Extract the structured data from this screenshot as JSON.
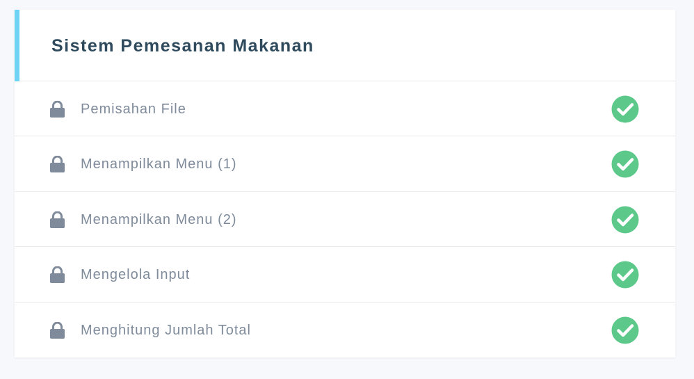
{
  "course": {
    "title": "Sistem Pemesanan Makanan"
  },
  "lessons": [
    {
      "label": "Pemisahan File",
      "status": "completed",
      "lock_icon": "lock-icon",
      "status_icon": "check-circle-icon"
    },
    {
      "label": "Menampilkan Menu (1)",
      "status": "completed",
      "lock_icon": "lock-icon",
      "status_icon": "check-circle-icon"
    },
    {
      "label": "Menampilkan Menu (2)",
      "status": "completed",
      "lock_icon": "lock-icon",
      "status_icon": "check-circle-icon"
    },
    {
      "label": "Mengelola Input",
      "status": "completed",
      "lock_icon": "lock-icon",
      "status_icon": "check-circle-icon"
    },
    {
      "label": "Menghitung Jumlah Total",
      "status": "completed",
      "lock_icon": "lock-icon",
      "status_icon": "check-circle-icon"
    }
  ],
  "colors": {
    "accent": "#6fd3f5",
    "title": "#2e4a5c",
    "label": "#7f8b9a",
    "lock": "#7f8b9a",
    "check": "#5cc98a"
  }
}
